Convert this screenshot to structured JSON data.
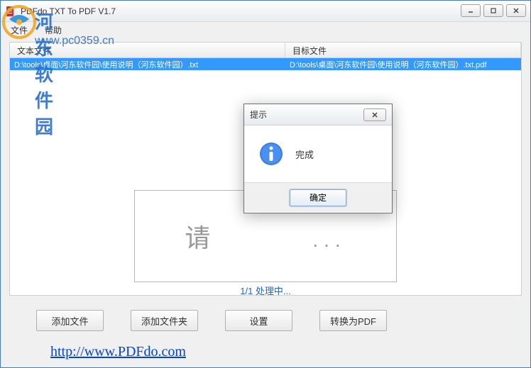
{
  "window": {
    "title": "PDFdo TXT To PDF V1.7"
  },
  "menu": {
    "file": "文件",
    "help": "帮助"
  },
  "watermark": {
    "text": "河东软件园",
    "url": "www.pc0359.cn"
  },
  "table": {
    "header1": "文本文件",
    "header2": "目标文件",
    "rows": [
      {
        "source": "D:\\tools\\桌面\\河东软件园\\使用说明（河东软件园）.txt",
        "target": "D:\\tools\\桌面\\河东软件园\\使用说明（河东软件园）.txt.pdf"
      }
    ]
  },
  "dropzone": {
    "prefix": "请",
    "suffix": "..."
  },
  "progress": "1/1 处理中...",
  "buttons": {
    "add_file": "添加文件",
    "add_folder": "添加文件夹",
    "settings": "设置",
    "convert": "转换为PDF"
  },
  "link": "http://www.PDFdo.com",
  "dialog": {
    "title": "提示",
    "message": "完成",
    "ok": "确定"
  }
}
